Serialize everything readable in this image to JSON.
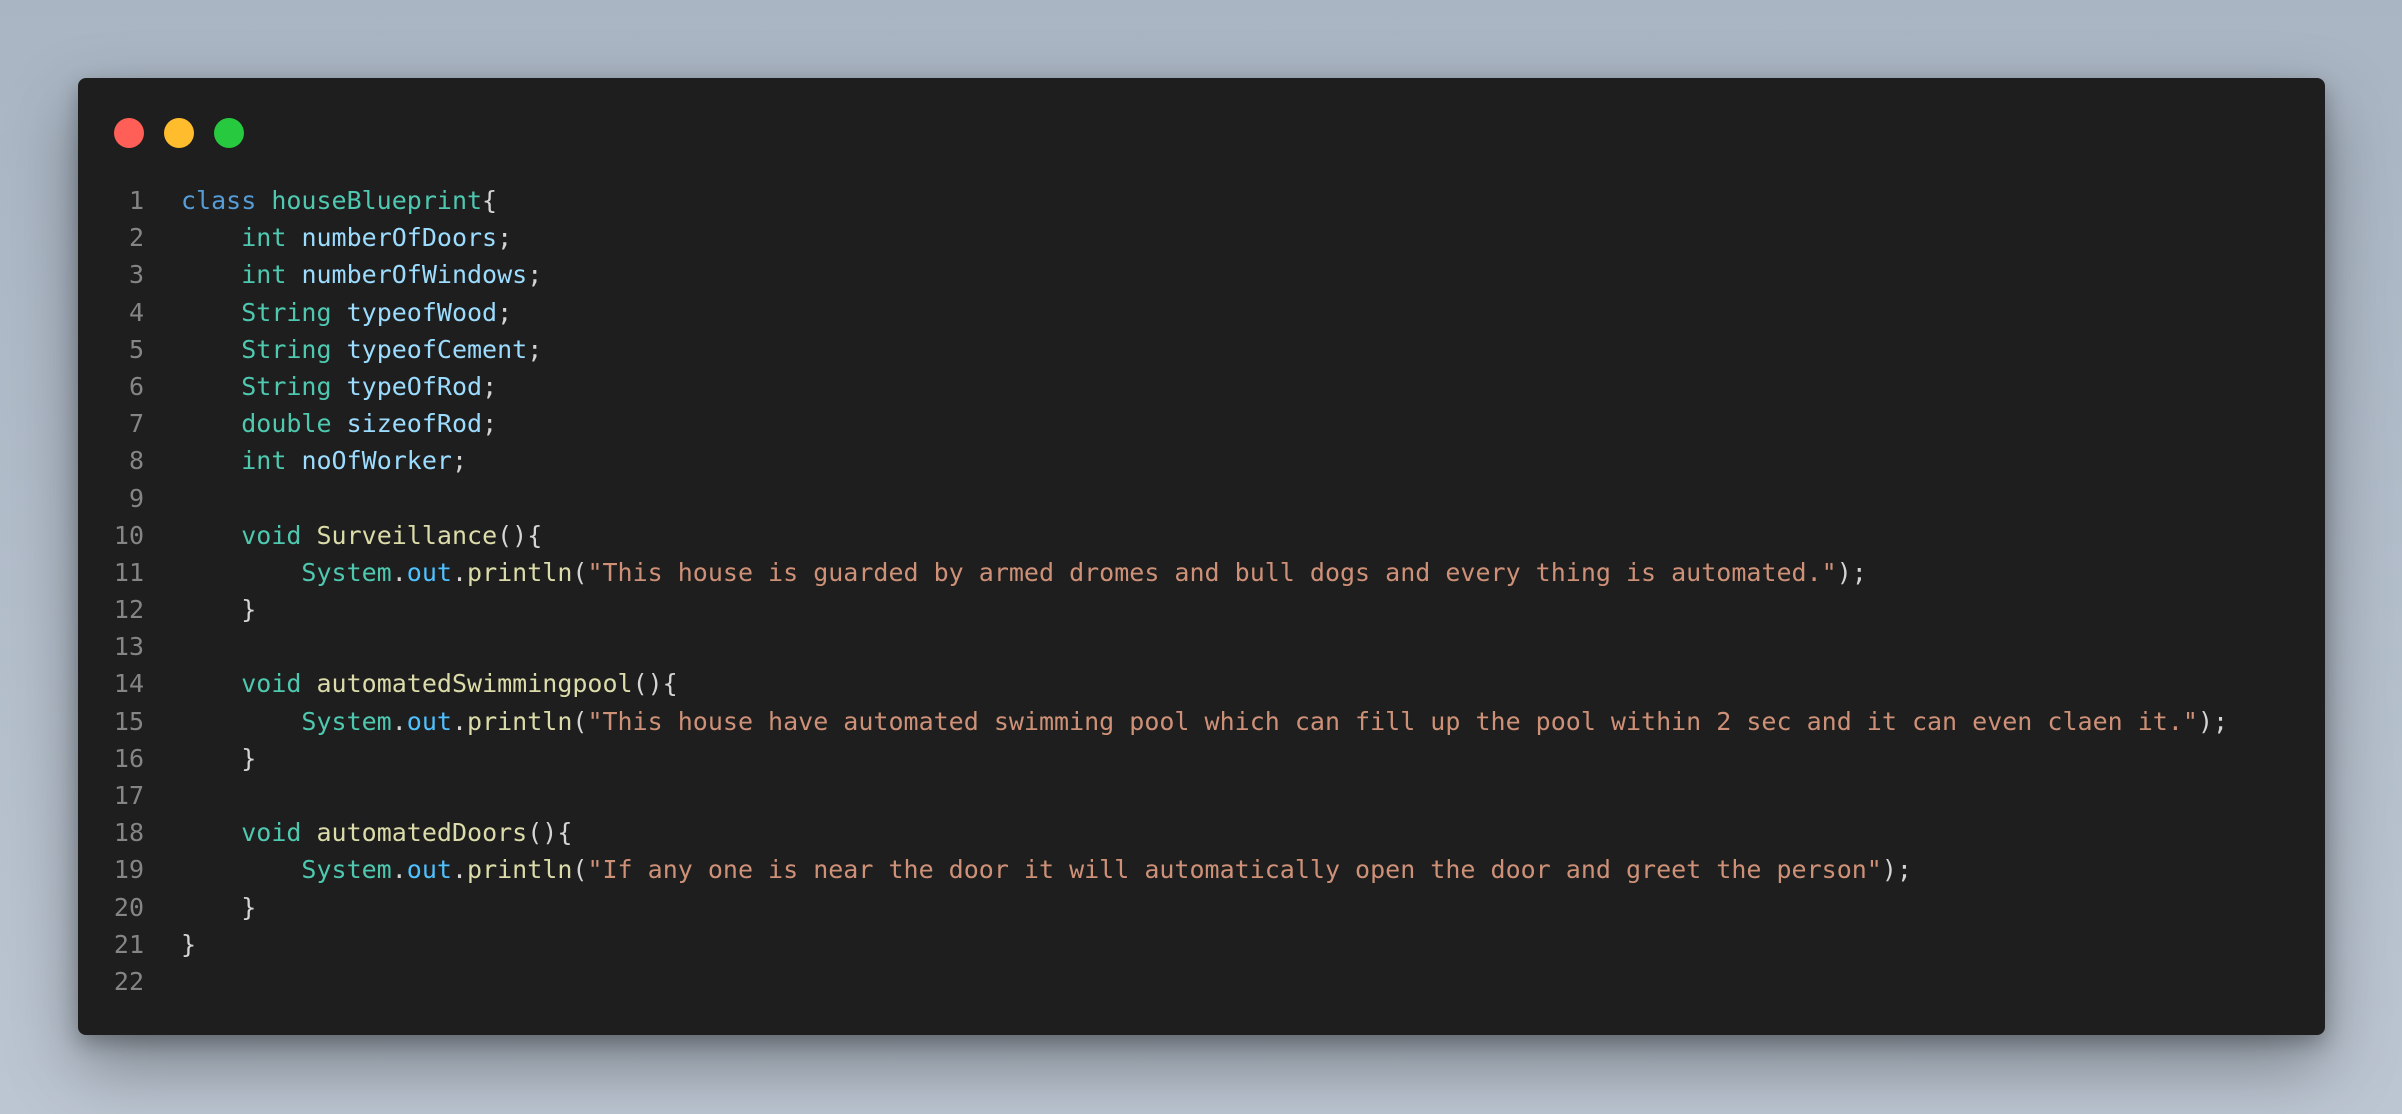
{
  "window": {
    "controls": [
      {
        "name": "close",
        "color": "#ff5f56"
      },
      {
        "name": "minimize",
        "color": "#ffbd2e"
      },
      {
        "name": "maximize",
        "color": "#27c93f"
      }
    ]
  },
  "editor": {
    "language": "java",
    "lines": [
      {
        "n": "1",
        "tokens": [
          {
            "t": "class",
            "c": "kw"
          },
          {
            "t": " ",
            "c": "punc"
          },
          {
            "t": "houseBlueprint",
            "c": "class"
          },
          {
            "t": "{",
            "c": "punc"
          }
        ]
      },
      {
        "n": "2",
        "tokens": [
          {
            "t": "    ",
            "c": "punc"
          },
          {
            "t": "int",
            "c": "type"
          },
          {
            "t": " ",
            "c": "punc"
          },
          {
            "t": "numberOfDoors",
            "c": "var"
          },
          {
            "t": ";",
            "c": "punc"
          }
        ]
      },
      {
        "n": "3",
        "tokens": [
          {
            "t": "    ",
            "c": "punc"
          },
          {
            "t": "int",
            "c": "type"
          },
          {
            "t": " ",
            "c": "punc"
          },
          {
            "t": "numberOfWindows",
            "c": "var"
          },
          {
            "t": ";",
            "c": "punc"
          }
        ]
      },
      {
        "n": "4",
        "tokens": [
          {
            "t": "    ",
            "c": "punc"
          },
          {
            "t": "String",
            "c": "type"
          },
          {
            "t": " ",
            "c": "punc"
          },
          {
            "t": "typeofWood",
            "c": "var"
          },
          {
            "t": ";",
            "c": "punc"
          }
        ]
      },
      {
        "n": "5",
        "tokens": [
          {
            "t": "    ",
            "c": "punc"
          },
          {
            "t": "String",
            "c": "type"
          },
          {
            "t": " ",
            "c": "punc"
          },
          {
            "t": "typeofCement",
            "c": "var"
          },
          {
            "t": ";",
            "c": "punc"
          }
        ]
      },
      {
        "n": "6",
        "tokens": [
          {
            "t": "    ",
            "c": "punc"
          },
          {
            "t": "String",
            "c": "type"
          },
          {
            "t": " ",
            "c": "punc"
          },
          {
            "t": "typeOfRod",
            "c": "var"
          },
          {
            "t": ";",
            "c": "punc"
          }
        ]
      },
      {
        "n": "7",
        "tokens": [
          {
            "t": "    ",
            "c": "punc"
          },
          {
            "t": "double",
            "c": "type"
          },
          {
            "t": " ",
            "c": "punc"
          },
          {
            "t": "sizeofRod",
            "c": "var"
          },
          {
            "t": ";",
            "c": "punc"
          }
        ]
      },
      {
        "n": "8",
        "tokens": [
          {
            "t": "    ",
            "c": "punc"
          },
          {
            "t": "int",
            "c": "type"
          },
          {
            "t": " ",
            "c": "punc"
          },
          {
            "t": "noOfWorker",
            "c": "var"
          },
          {
            "t": ";",
            "c": "punc"
          }
        ]
      },
      {
        "n": "9",
        "tokens": []
      },
      {
        "n": "10",
        "tokens": [
          {
            "t": "    ",
            "c": "punc"
          },
          {
            "t": "void",
            "c": "type"
          },
          {
            "t": " ",
            "c": "punc"
          },
          {
            "t": "Surveillance",
            "c": "fn"
          },
          {
            "t": "(){",
            "c": "punc"
          }
        ]
      },
      {
        "n": "11",
        "tokens": [
          {
            "t": "        ",
            "c": "punc"
          },
          {
            "t": "System",
            "c": "type"
          },
          {
            "t": ".",
            "c": "punc"
          },
          {
            "t": "out",
            "c": "prop"
          },
          {
            "t": ".",
            "c": "punc"
          },
          {
            "t": "println",
            "c": "fn"
          },
          {
            "t": "(",
            "c": "punc"
          },
          {
            "t": "\"This house is guarded by armed dromes and bull dogs and every thing is automated.\"",
            "c": "str"
          },
          {
            "t": ");",
            "c": "punc"
          }
        ]
      },
      {
        "n": "12",
        "tokens": [
          {
            "t": "    ",
            "c": "punc"
          },
          {
            "t": "}",
            "c": "punc"
          }
        ]
      },
      {
        "n": "13",
        "tokens": []
      },
      {
        "n": "14",
        "tokens": [
          {
            "t": "    ",
            "c": "punc"
          },
          {
            "t": "void",
            "c": "type"
          },
          {
            "t": " ",
            "c": "punc"
          },
          {
            "t": "automatedSwimmingpool",
            "c": "fn"
          },
          {
            "t": "(){",
            "c": "punc"
          }
        ]
      },
      {
        "n": "15",
        "tokens": [
          {
            "t": "        ",
            "c": "punc"
          },
          {
            "t": "System",
            "c": "type"
          },
          {
            "t": ".",
            "c": "punc"
          },
          {
            "t": "out",
            "c": "prop"
          },
          {
            "t": ".",
            "c": "punc"
          },
          {
            "t": "println",
            "c": "fn"
          },
          {
            "t": "(",
            "c": "punc"
          },
          {
            "t": "\"This house have automated swimming pool which can fill up the pool within 2 sec and it can even claen it.\"",
            "c": "str"
          },
          {
            "t": ");",
            "c": "punc"
          }
        ]
      },
      {
        "n": "16",
        "tokens": [
          {
            "t": "    ",
            "c": "punc"
          },
          {
            "t": "}",
            "c": "punc"
          }
        ]
      },
      {
        "n": "17",
        "tokens": []
      },
      {
        "n": "18",
        "tokens": [
          {
            "t": "    ",
            "c": "punc"
          },
          {
            "t": "void",
            "c": "type"
          },
          {
            "t": " ",
            "c": "punc"
          },
          {
            "t": "automatedDoors",
            "c": "fn"
          },
          {
            "t": "(){",
            "c": "punc"
          }
        ]
      },
      {
        "n": "19",
        "tokens": [
          {
            "t": "        ",
            "c": "punc"
          },
          {
            "t": "System",
            "c": "type"
          },
          {
            "t": ".",
            "c": "punc"
          },
          {
            "t": "out",
            "c": "prop"
          },
          {
            "t": ".",
            "c": "punc"
          },
          {
            "t": "println",
            "c": "fn"
          },
          {
            "t": "(",
            "c": "punc"
          },
          {
            "t": "\"If any one is near the door it will automatically open the door and greet the person\"",
            "c": "str"
          },
          {
            "t": ");",
            "c": "punc"
          }
        ]
      },
      {
        "n": "20",
        "tokens": [
          {
            "t": "    ",
            "c": "punc"
          },
          {
            "t": "}",
            "c": "punc"
          }
        ]
      },
      {
        "n": "21",
        "tokens": [
          {
            "t": "}",
            "c": "punc"
          }
        ]
      },
      {
        "n": "22",
        "tokens": []
      }
    ]
  }
}
